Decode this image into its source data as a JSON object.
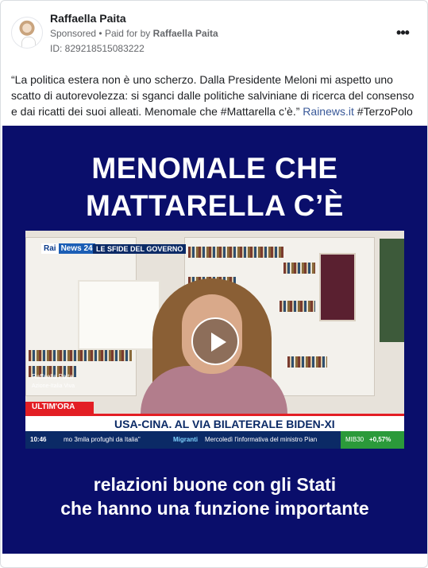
{
  "post": {
    "page_name": "Raffaella Paita",
    "sponsored": "Sponsored",
    "bullet": "•",
    "paid_for_prefix": "Paid for by",
    "paid_for_by": "Raffaella Paita",
    "ad_id": "ID: 829218515083222",
    "more_label": "•••",
    "caption_text": "“La politica estera non è uno scherzo. Dalla Presidente Meloni mi aspetto uno scatto di autorevolezza: si sganci dalle politiche salviniane di ricerca del consenso e dai ricatti dei suoi alleati. Menomale che #Mattarella c’è.” ",
    "caption_link": "Rainews.it",
    "caption_hashtag": " #TerzoPolo"
  },
  "media": {
    "title_line1": "MENOMALE CHE",
    "title_line2": "MATTARELLA C’È",
    "subtitle_line1": "relazioni buone con gli Stati",
    "subtitle_line2": "che hanno una funzione importante",
    "background_color": "#0a0e6b"
  },
  "video": {
    "logo_rai": "Rai",
    "logo_news": "News 24",
    "program": "LE SFIDE DEL GOVERNO",
    "speaker_name": "Raffaella Paita",
    "speaker_role": "Azione-Italia Viva",
    "breaking_label": "ULTIM'ORA",
    "headline": "USA-CINA. AL VIA BILATERALE BIDEN-XI",
    "ticker_time": "10:46",
    "ticker_text1": "mo 3mila profughi da Italia\"",
    "ticker_category": "Migranti",
    "ticker_text2": "Mercoledì l'informativa del ministro Pian",
    "index_label": "MIB30",
    "index_value": "+0,57%",
    "play_icon": "play-icon"
  }
}
